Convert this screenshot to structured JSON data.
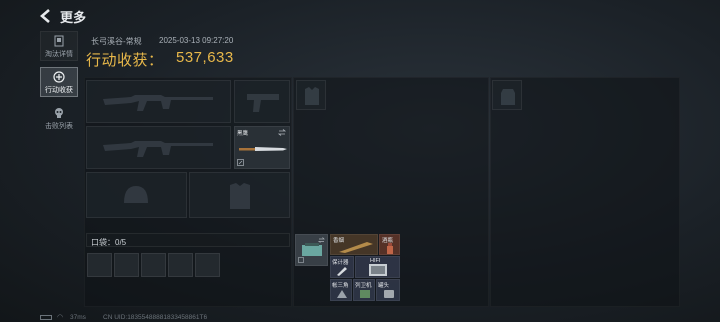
{
  "header": {
    "title": "更多"
  },
  "nav": {
    "tabs": [
      {
        "label": "淘汰详情",
        "icon": "document-icon"
      },
      {
        "label": "行动收获",
        "icon": "loot-icon",
        "active": true
      },
      {
        "label": "击败列表",
        "icon": "skull-icon"
      }
    ]
  },
  "raid": {
    "map": "长弓溪谷-常规",
    "time": "2025-03-13 09:27:20",
    "haul_label": "行动收获：",
    "haul_value": "537,633"
  },
  "loadout": {
    "melee_label": "黑鹰",
    "pocket_label": "口袋：0/5"
  },
  "backpack": {
    "items": [
      "香烟",
      "酒瓶",
      "保计器",
      "HIFI",
      "帐三角",
      "列卫机",
      "罐头"
    ]
  },
  "footer": {
    "ping": "37ms",
    "uid": "CN UID:18355488881833458861T6"
  },
  "colors": {
    "accent_gold": "#e8b84a",
    "active_tab": "#bec8d2"
  }
}
